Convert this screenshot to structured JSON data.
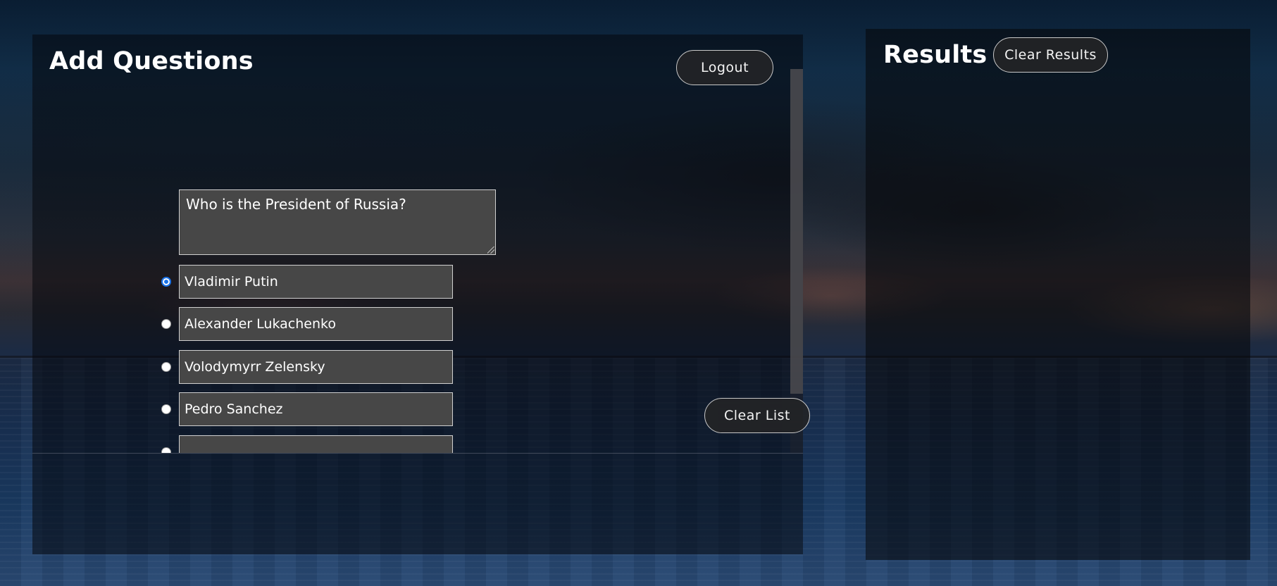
{
  "add_questions": {
    "title": "Add Questions",
    "logout_label": "Logout",
    "clear_list_label": "Clear List",
    "question_text": "Who is the President of Russia?",
    "answers": [
      {
        "label": "Vladimir Putin",
        "selected": true
      },
      {
        "label": "Alexander Lukachenko",
        "selected": false
      },
      {
        "label": "Volodymyrr Zelensky",
        "selected": false
      },
      {
        "label": "Pedro Sanchez",
        "selected": false
      },
      {
        "label": "",
        "selected": false
      }
    ]
  },
  "results": {
    "title": "Results",
    "clear_results_label": "Clear Results"
  },
  "colors": {
    "panel": "#06080c",
    "input_bg": "#474747",
    "input_border": "#d0d0d0",
    "radio_selected": "#1a73e8",
    "button_bg": "#232426"
  }
}
